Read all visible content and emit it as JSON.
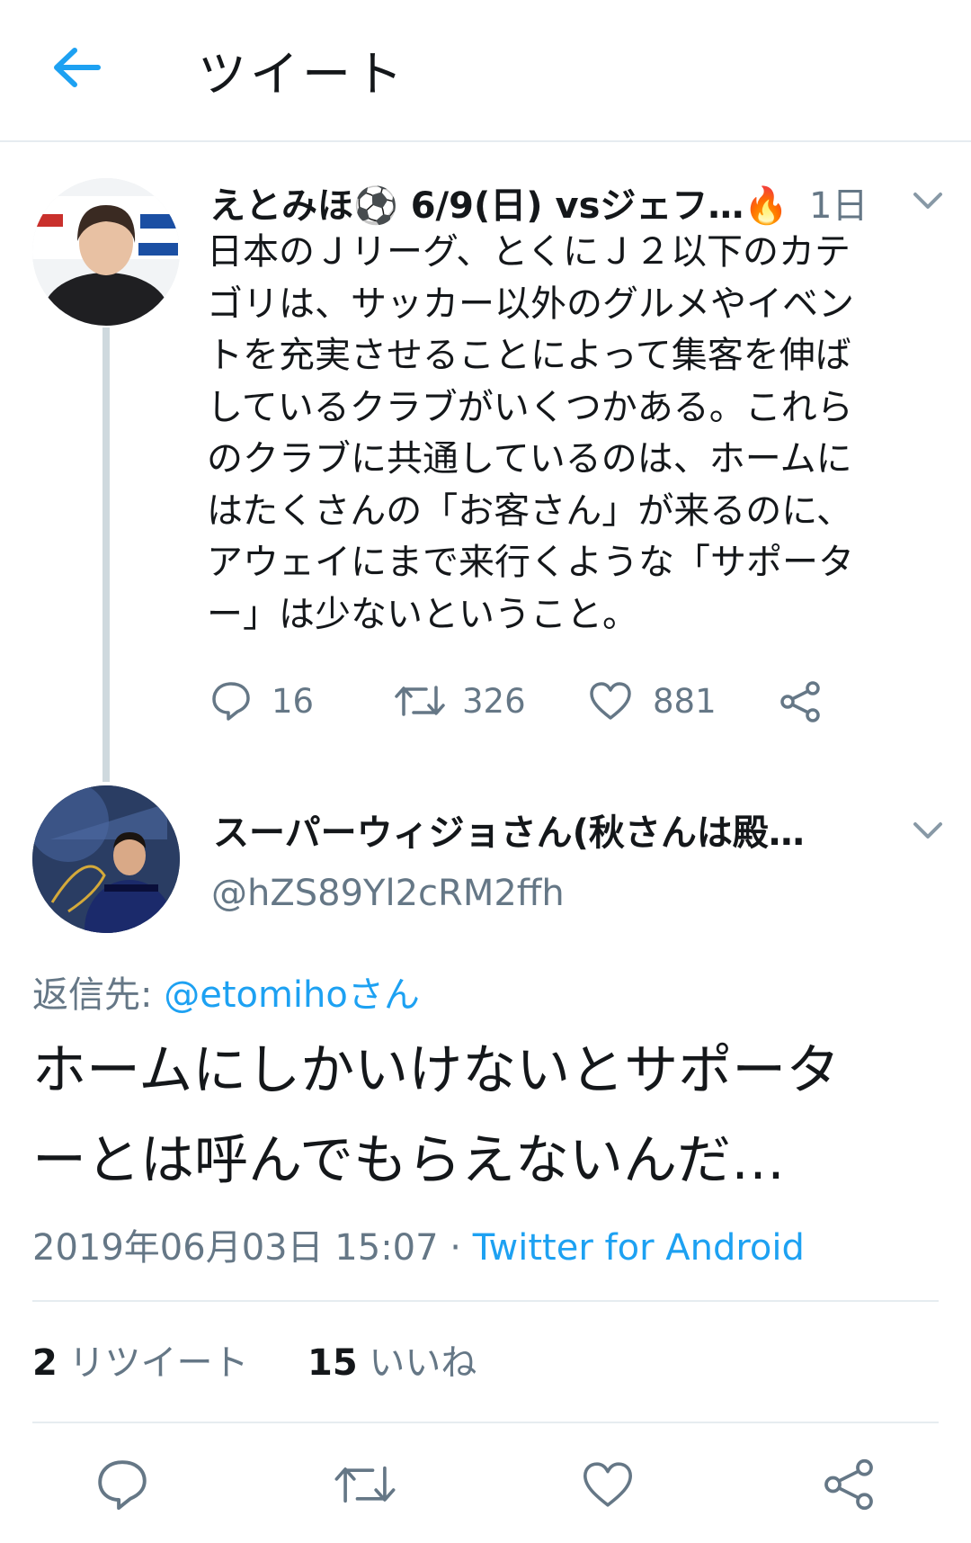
{
  "header": {
    "title": "ツイート",
    "back_icon": "arrow-left-icon",
    "accent": "#1da1f2"
  },
  "tweet1": {
    "name": "えとみほ⚽ 6/9(日) vsジェフ…🔥",
    "time": "1日",
    "text_lines": [
      "日本のＪリーグ、とくにＪ２以下のカテ",
      "ゴリは、サッカー以外のグルメやイベン",
      "トを充実させることによって集客を伸ば",
      "しているクラブがいくつかある。これら",
      "のクラブに共通しているのは、ホームに",
      "はたくさんの「お客さん」が来るのに、",
      "アウェイにまで来行くような「サポータ",
      "ー」は少ないということ。"
    ],
    "replies": "16",
    "retweets": "326",
    "likes": "881"
  },
  "tweet2": {
    "name": "スーパーウィジョさん(秋さんは殿…",
    "handle": "@hZS89Yl2cRM2ffh",
    "reply_prefix": "返信先: ",
    "reply_mention": "@etomihoさん",
    "text_lines": [
      "ホームにしかいけないとサポータ",
      "ーとは呼んでもらえないんだ…"
    ],
    "datetime": "2019年06月03日 15:07 · ",
    "source": "Twitter for Android",
    "retweet_count": "2",
    "retweet_label": " リツイート",
    "like_count": "15",
    "like_label": " いいね"
  },
  "colors": {
    "secondary_text": "#657786",
    "link": "#1da1f2",
    "divider": "#e6ecf0"
  }
}
